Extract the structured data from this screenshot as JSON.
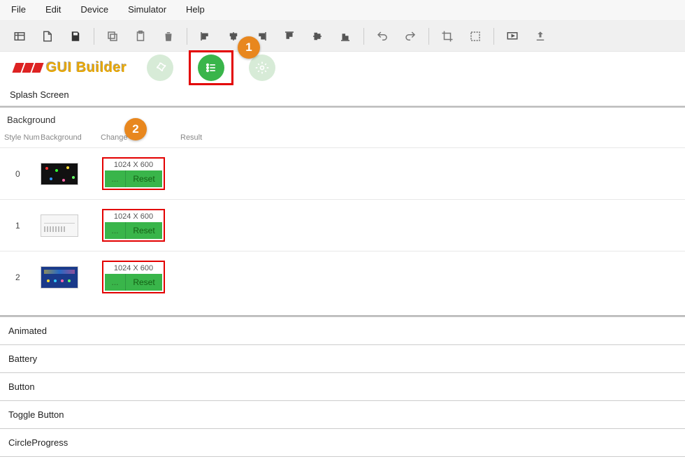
{
  "menu": {
    "items": [
      "File",
      "Edit",
      "Device",
      "Simulator",
      "Help"
    ]
  },
  "logo": {
    "text": "GUI Builder"
  },
  "callouts": {
    "one": "1",
    "two": "2"
  },
  "sections": {
    "splash": "Splash Screen",
    "background": "Background"
  },
  "columns": {
    "stylenum": "Style Num",
    "background": "Background",
    "change": "Change",
    "result": "Result"
  },
  "rows": [
    {
      "num": "0",
      "dim": "1024 X 600",
      "dots": "...",
      "reset": "Reset",
      "thumb": "dark"
    },
    {
      "num": "1",
      "dim": "1024 X 600",
      "dots": "...",
      "reset": "Reset",
      "thumb": "light"
    },
    {
      "num": "2",
      "dim": "1024 X 600",
      "dots": "...",
      "reset": "Reset",
      "thumb": "blue"
    }
  ],
  "accordion": [
    "Animated",
    "Battery",
    "Button",
    "Toggle Button",
    "CircleProgress"
  ],
  "colors": {
    "accent_green": "#39b54a",
    "callout_orange": "#e8871e",
    "highlight_red": "#e30000"
  }
}
